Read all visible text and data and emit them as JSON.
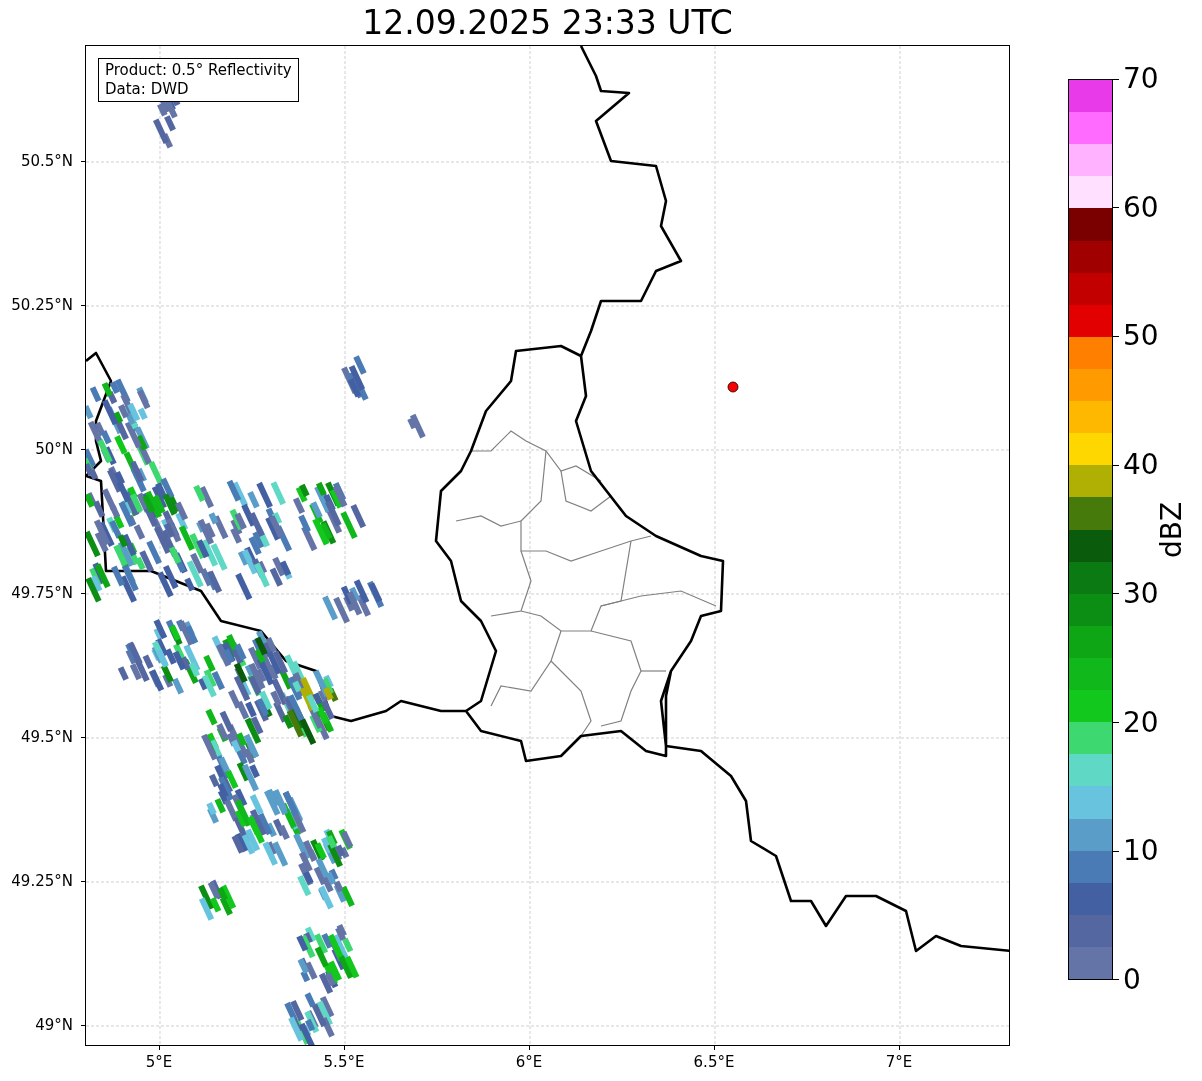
{
  "title": "12.09.2025 23:33 UTC",
  "info_box": {
    "lines": [
      "Product: 0.5° Reflectivity",
      "Data: DWD"
    ]
  },
  "y_ticks": [
    "50.5°N",
    "50.25°N",
    "50°N",
    "49.75°N",
    "49.5°N",
    "49.25°N",
    "49°N"
  ],
  "x_ticks": [
    "5°E",
    "5.5°E",
    "6°E",
    "6.5°E",
    "7°E"
  ],
  "colorbar": {
    "label": "dBZ",
    "ticks": [
      "70",
      "60",
      "50",
      "40",
      "30",
      "20",
      "10",
      "0"
    ],
    "bins": [
      {
        "color": "#e93ae9"
      },
      {
        "color": "#ff6bff"
      },
      {
        "color": "#ffb2ff"
      },
      {
        "color": "#ffe0ff"
      },
      {
        "color": "#7a0000"
      },
      {
        "color": "#a00000"
      },
      {
        "color": "#c20000"
      },
      {
        "color": "#e30000"
      },
      {
        "color": "#ff8000"
      },
      {
        "color": "#ff9a00"
      },
      {
        "color": "#ffb800"
      },
      {
        "color": "#ffd700"
      },
      {
        "color": "#b0b004"
      },
      {
        "color": "#467a0a"
      },
      {
        "color": "#0a5c0c"
      },
      {
        "color": "#0c7a12"
      },
      {
        "color": "#0c8e14"
      },
      {
        "color": "#0fa616"
      },
      {
        "color": "#10b81b"
      },
      {
        "color": "#12c81c"
      },
      {
        "color": "#3dd86f"
      },
      {
        "color": "#60d8c6"
      },
      {
        "color": "#68c3de"
      },
      {
        "color": "#5a9dc8"
      },
      {
        "color": "#4a7bb4"
      },
      {
        "color": "#4360a2"
      },
      {
        "color": "#5567a0"
      },
      {
        "color": "#6474a6"
      }
    ]
  }
}
